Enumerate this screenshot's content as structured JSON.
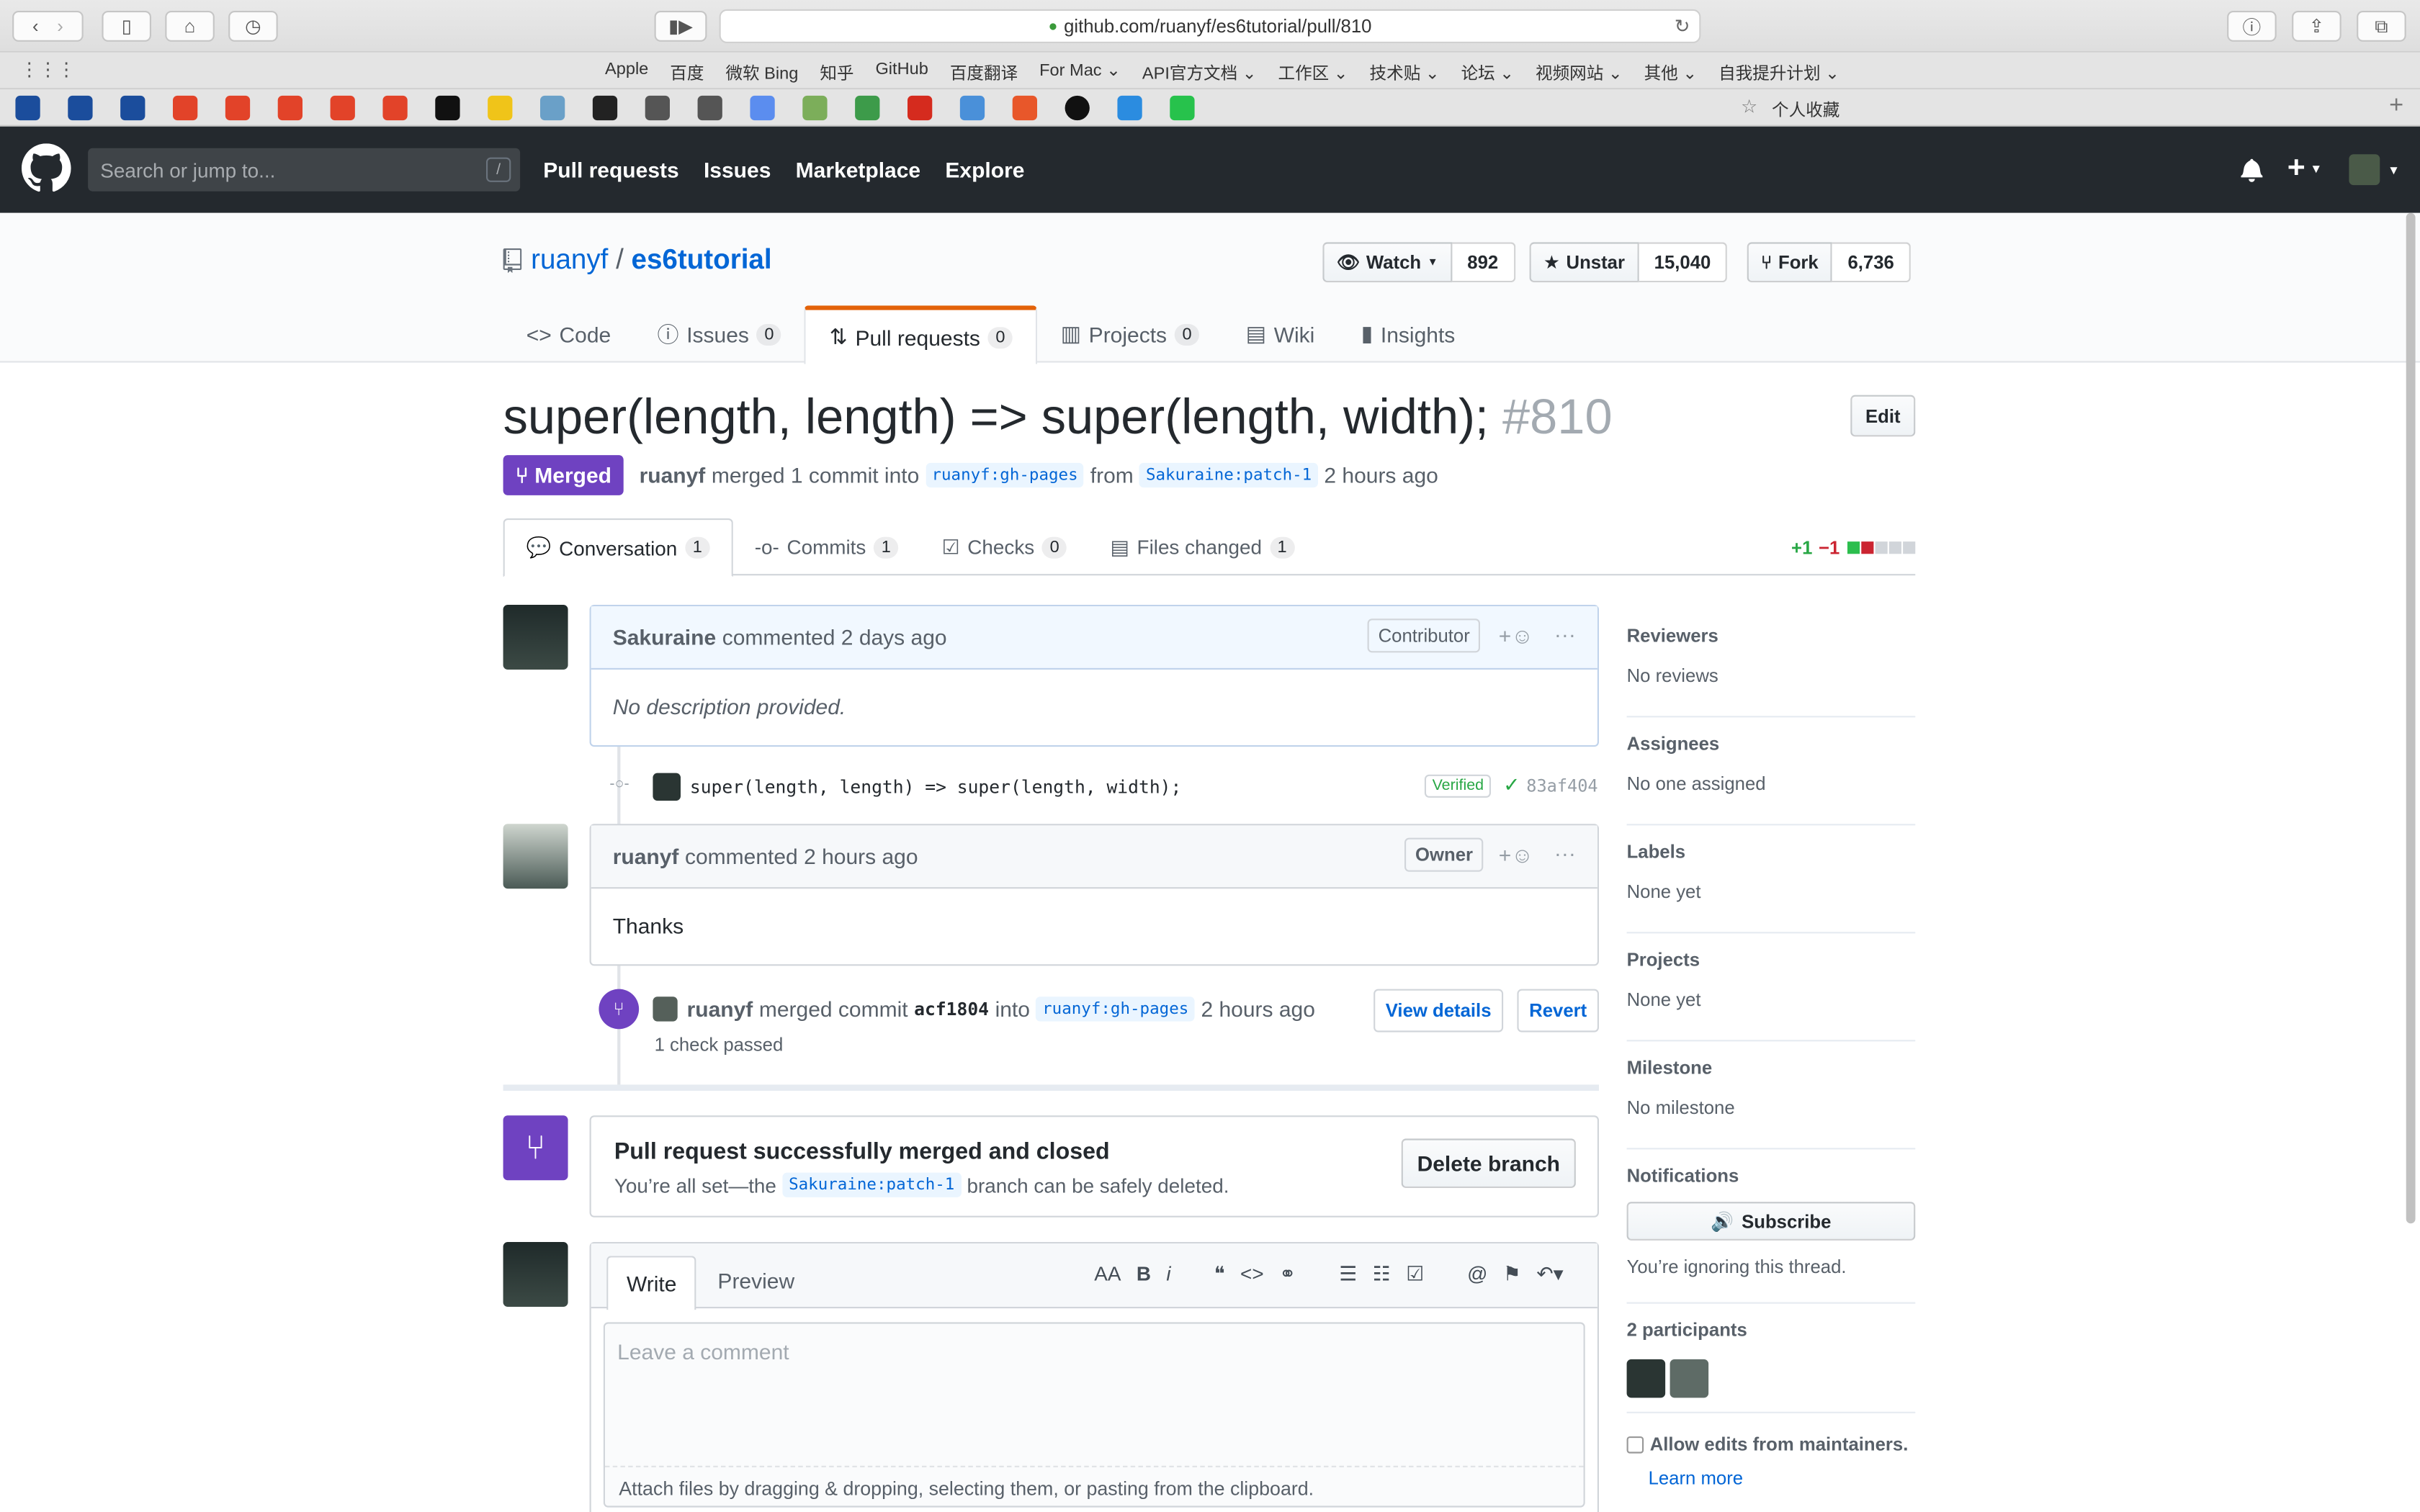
{
  "browser": {
    "url": "github.com/ruanyf/es6tutorial/pull/810",
    "bookmarks": [
      "Apple",
      "百度",
      "微软 Bing",
      "知乎",
      "GitHub",
      "百度翻译",
      "For Mac ⌄",
      "API官方文档 ⌄",
      "工作区 ⌄",
      "技术贴 ⌄",
      "论坛 ⌄",
      "视频网站 ⌄",
      "其他 ⌄",
      "自我提升计划 ⌄"
    ],
    "favorites_label": "个人收藏"
  },
  "header": {
    "search_placeholder": "Search or jump to...",
    "slash_key": "/",
    "nav": [
      "Pull requests",
      "Issues",
      "Marketplace",
      "Explore"
    ],
    "plus": "+"
  },
  "repo": {
    "owner": "ruanyf",
    "separator": "/",
    "name": "es6tutorial",
    "watch_label": "Watch",
    "watch_count": "892",
    "star_label": "Unstar",
    "star_count": "15,040",
    "fork_label": "Fork",
    "fork_count": "6,736",
    "tabs": [
      {
        "label": "Code",
        "count": ""
      },
      {
        "label": "Issues",
        "count": "0"
      },
      {
        "label": "Pull requests",
        "count": "0"
      },
      {
        "label": "Projects",
        "count": "0"
      },
      {
        "label": "Wiki",
        "count": ""
      },
      {
        "label": "Insights",
        "count": ""
      }
    ]
  },
  "pr": {
    "title": "super(length, length) => super(length, width);",
    "number": "#810",
    "edit_label": "Edit",
    "state": "Merged",
    "author": "ruanyf",
    "meta_text": "merged 1 commit into",
    "base": "ruanyf:gh-pages",
    "from_text": "from",
    "head": "Sakuraine:patch-1",
    "time": "2 hours ago",
    "tabs": [
      {
        "label": "Conversation",
        "count": "1"
      },
      {
        "label": "Commits",
        "count": "1"
      },
      {
        "label": "Checks",
        "count": "0"
      },
      {
        "label": "Files changed",
        "count": "1"
      }
    ],
    "additions": "+1",
    "deletions": "−1"
  },
  "timeline": {
    "comment1": {
      "author": "Sakuraine",
      "action": "commented 2 days ago",
      "badge": "Contributor",
      "body": "No description provided."
    },
    "commit": {
      "message": "super(length, length) => super(length, width);",
      "verified": "Verified",
      "sha": "83af404"
    },
    "comment2": {
      "author": "ruanyf",
      "action": "commented 2 hours ago",
      "badge": "Owner",
      "body": "Thanks"
    },
    "merge_event": {
      "author": "ruanyf",
      "text1": "merged commit",
      "sha": "acf1804",
      "text2": "into",
      "base": "ruanyf:gh-pages",
      "time": "2 hours ago",
      "checks": "1 check passed",
      "view_details": "View details",
      "revert": "Revert"
    },
    "merged_box": {
      "title": "Pull request successfully merged and closed",
      "text_before": "You’re all set—the",
      "branch": "Sakuraine:patch-1",
      "text_after": "branch can be safely deleted.",
      "delete_label": "Delete branch"
    },
    "editor": {
      "write_tab": "Write",
      "preview_tab": "Preview",
      "placeholder": "Leave a comment",
      "attach_text": "Attach files by dragging & dropping, selecting them, or pasting from the clipboard."
    }
  },
  "sidebar": {
    "reviewers": {
      "heading": "Reviewers",
      "value": "No reviews"
    },
    "assignees": {
      "heading": "Assignees",
      "value": "No one assigned"
    },
    "labels": {
      "heading": "Labels",
      "value": "None yet"
    },
    "projects": {
      "heading": "Projects",
      "value": "None yet"
    },
    "milestone": {
      "heading": "Milestone",
      "value": "No milestone"
    },
    "notifications": {
      "heading": "Notifications",
      "button": "Subscribe",
      "note": "You’re ignoring this thread."
    },
    "participants": {
      "heading": "2 participants"
    },
    "allow_edits": "Allow edits from maintainers.",
    "learn_more": "Learn more"
  },
  "colors": {
    "merged": "#6f42c1",
    "link": "#0366d6",
    "header_bg": "#24292e",
    "add_green": "#28a745",
    "del_red": "#cb2431"
  }
}
